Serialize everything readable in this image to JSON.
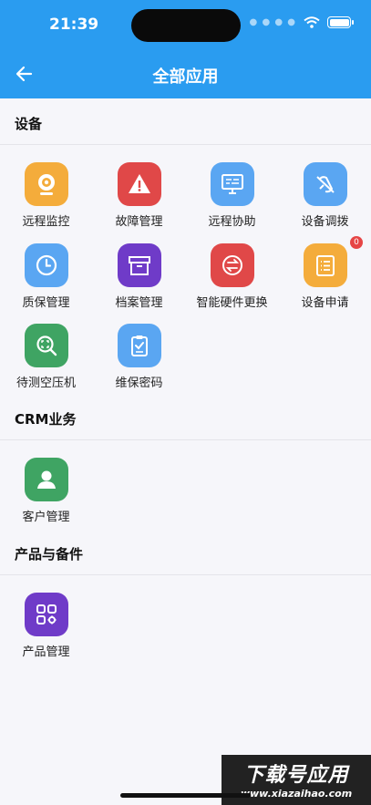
{
  "status": {
    "time": "21:39"
  },
  "header": {
    "title": "全部应用",
    "back_icon": "arrow-left-icon"
  },
  "colors": {
    "header": "#2a9cf0",
    "orange": "#f4ac3b",
    "red": "#e04848",
    "blue": "#5aa6f2",
    "purple": "#6f3bc8",
    "green": "#3fa463",
    "badge": "#e64545"
  },
  "sections": [
    {
      "title": "设备",
      "items": [
        {
          "label": "远程监控",
          "icon": "webcam-icon"
        },
        {
          "label": "故障管理",
          "icon": "warning-icon"
        },
        {
          "label": "远程协助",
          "icon": "monitor-icon"
        },
        {
          "label": "设备调拨",
          "icon": "transfer-icon"
        },
        {
          "label": "质保管理",
          "icon": "clock-icon"
        },
        {
          "label": "档案管理",
          "icon": "archive-box-icon"
        },
        {
          "label": "智能硬件更换",
          "icon": "swap-icon"
        },
        {
          "label": "设备申请",
          "icon": "list-document-icon",
          "badge": "0"
        },
        {
          "label": "待测空压机",
          "icon": "scan-search-icon"
        },
        {
          "label": "维保密码",
          "icon": "clipboard-check-icon"
        }
      ]
    },
    {
      "title": "CRM业务",
      "items": [
        {
          "label": "客户管理",
          "icon": "user-icon"
        }
      ]
    },
    {
      "title": "产品与备件",
      "items": [
        {
          "label": "产品管理",
          "icon": "apps-gear-icon"
        }
      ]
    }
  ],
  "watermark": {
    "main": "下载号应用",
    "sub": "www.xiazaihao.com"
  }
}
